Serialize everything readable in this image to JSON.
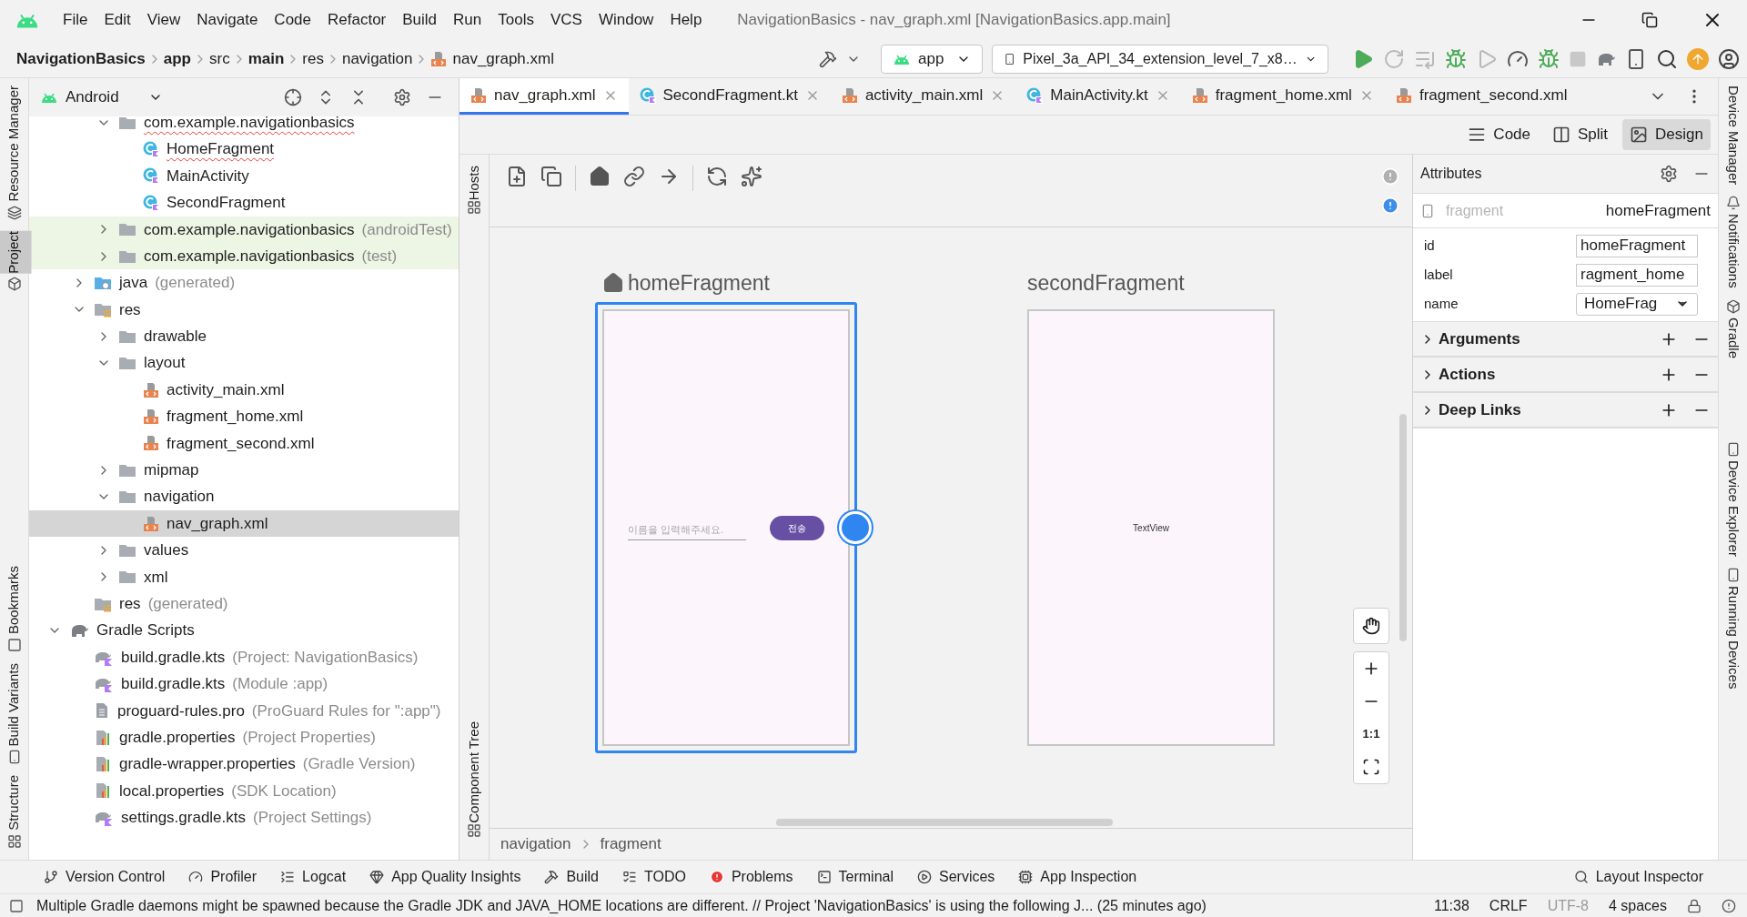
{
  "menu_bar": {
    "items": [
      "File",
      "Edit",
      "View",
      "Navigate",
      "Code",
      "Refactor",
      "Build",
      "Run",
      "Tools",
      "VCS",
      "Window",
      "Help"
    ],
    "title": "NavigationBasics - nav_graph.xml [NavigationBasics.app.main]"
  },
  "nav_bar": {
    "breadcrumbs": [
      {
        "label": "NavigationBasics",
        "bold": true,
        "kind": "plain"
      },
      {
        "label": "app",
        "bold": true,
        "kind": "plain"
      },
      {
        "label": "src",
        "bold": false,
        "kind": "plain"
      },
      {
        "label": "main",
        "bold": true,
        "kind": "plain"
      },
      {
        "label": "res",
        "bold": false,
        "kind": "plain"
      },
      {
        "label": "navigation",
        "bold": false,
        "kind": "plain"
      },
      {
        "label": "nav_graph.xml",
        "bold": false,
        "kind": "xml"
      }
    ],
    "run_config": "app",
    "device": "Pixel_3a_API_34_extension_level_7_x8…"
  },
  "left_stripe": [
    {
      "label": "Resource Manager",
      "selected": false
    },
    {
      "label": "Project",
      "selected": true
    },
    {
      "label": "Bookmarks",
      "selected": false
    },
    {
      "label": "Build Variants",
      "selected": false
    },
    {
      "label": "Structure",
      "selected": false
    }
  ],
  "project": {
    "view": "Android",
    "packages": [
      {
        "label": "com.example.navigationbasics",
        "kind": "folder",
        "expanded": true,
        "selected": false,
        "error": true,
        "children": [
          {
            "label": "HomeFragment",
            "kind": "class",
            "selected": false,
            "error": true
          },
          {
            "label": "MainActivity",
            "kind": "class",
            "selected": false
          },
          {
            "label": "SecondFragment",
            "kind": "class",
            "selected": false
          }
        ]
      },
      {
        "label": "com.example.navigationbasics",
        "note": "(androidTest)",
        "kind": "folder",
        "expanded": false,
        "selected": false,
        "test_source": true
      },
      {
        "label": "com.example.navigationbasics",
        "note": "(test)",
        "kind": "folder",
        "expanded": false,
        "selected": false,
        "test_source": true
      }
    ],
    "app_folders": [
      {
        "label": "java",
        "note": "(generated)",
        "kind": "gen",
        "expanded": false,
        "selected": false
      },
      {
        "label": "res",
        "kind": "res",
        "expanded": true,
        "selected": false,
        "children": [
          {
            "label": "drawable",
            "kind": "folder",
            "expanded": false,
            "selected": false
          },
          {
            "label": "layout",
            "kind": "folder",
            "expanded": true,
            "selected": false,
            "children": [
              {
                "label": "activity_main.xml",
                "kind": "xml",
                "selected": false
              },
              {
                "label": "fragment_home.xml",
                "kind": "xml",
                "selected": false
              },
              {
                "label": "fragment_second.xml",
                "kind": "xml",
                "selected": false
              }
            ]
          },
          {
            "label": "mipmap",
            "kind": "folder",
            "expanded": false,
            "selected": false
          },
          {
            "label": "navigation",
            "kind": "folder",
            "expanded": true,
            "selected": false,
            "children": [
              {
                "label": "nav_graph.xml",
                "kind": "xml",
                "selected": true
              }
            ]
          },
          {
            "label": "values",
            "kind": "folder",
            "expanded": false,
            "selected": false
          },
          {
            "label": "xml",
            "kind": "folder",
            "expanded": false,
            "selected": false
          }
        ]
      },
      {
        "label": "res",
        "note": "(generated)",
        "kind": "res",
        "selected": false
      }
    ],
    "gradle": [
      {
        "label": "Gradle Scripts",
        "kind": "gradle",
        "expanded": true,
        "selected": false,
        "children": [
          {
            "label": "build.gradle.kts",
            "note": "(Project: NavigationBasics)",
            "kind": "kts",
            "selected": false
          },
          {
            "label": "build.gradle.kts",
            "note": "(Module :app)",
            "kind": "kts",
            "selected": false
          },
          {
            "label": "proguard-rules.pro",
            "note": "(ProGuard Rules for \":app\")",
            "kind": "file",
            "selected": false
          },
          {
            "label": "gradle.properties",
            "note": "(Project Properties)",
            "kind": "props",
            "selected": false
          },
          {
            "label": "gradle-wrapper.properties",
            "note": "(Gradle Version)",
            "kind": "props",
            "selected": false
          },
          {
            "label": "local.properties",
            "note": "(SDK Location)",
            "kind": "props",
            "selected": false
          },
          {
            "label": "settings.gradle.kts",
            "note": "(Project Settings)",
            "kind": "kts",
            "selected": false
          }
        ]
      }
    ]
  },
  "editor_tabs": [
    {
      "label": "nav_graph.xml",
      "kind": "xml",
      "selected": true,
      "closable": true
    },
    {
      "label": "SecondFragment.kt",
      "kind": "class",
      "selected": false,
      "closable": true
    },
    {
      "label": "activity_main.xml",
      "kind": "xml",
      "selected": false,
      "closable": true
    },
    {
      "label": "MainActivity.kt",
      "kind": "class",
      "selected": false,
      "closable": true
    },
    {
      "label": "fragment_home.xml",
      "kind": "xml",
      "selected": false,
      "closable": true
    },
    {
      "label": "fragment_second.xml",
      "kind": "xml",
      "selected": false,
      "closable": false
    }
  ],
  "view_modes": [
    {
      "label": "Code",
      "selected": false
    },
    {
      "label": "Split",
      "selected": false
    },
    {
      "label": "Design",
      "selected": true
    }
  ],
  "design_side_tabs": [
    "Hosts",
    "Component Tree"
  ],
  "canvas": {
    "destinations": [
      {
        "title": "homeFragment",
        "start": true,
        "selected": true,
        "kind": "form",
        "placeholder": "이름을 입력해주세요.",
        "button": "전송"
      },
      {
        "title": "secondFragment",
        "start": false,
        "selected": false,
        "kind": "text",
        "text": "TextView"
      }
    ],
    "zoom_reset": "1:1"
  },
  "attributes": {
    "title": "Attributes",
    "component_type": "fragment",
    "component_id": "homeFragment",
    "fields": [
      {
        "label": "id",
        "value": "homeFragment",
        "kind": "text"
      },
      {
        "label": "label",
        "value": "ragment_home",
        "kind": "text"
      },
      {
        "label": "name",
        "value": "HomeFrag",
        "kind": "dropdown"
      }
    ],
    "sections": [
      {
        "label": "Arguments",
        "expanded": false
      },
      {
        "label": "Actions",
        "expanded": false
      },
      {
        "label": "Deep Links",
        "expanded": false
      }
    ]
  },
  "design_breadcrumb": [
    "navigation",
    "fragment"
  ],
  "right_stripe": [
    "Device Manager",
    "Notifications",
    "Gradle",
    "Device Explorer",
    "Running Devices"
  ],
  "tool_windows": [
    "Version Control",
    "Profiler",
    "Logcat",
    "App Quality Insights",
    "Build",
    "TODO",
    "Problems",
    "Terminal",
    "Services",
    "App Inspection"
  ],
  "layout_inspector": "Layout Inspector",
  "status": {
    "message": "Multiple Gradle daemons might be spawned because the Gradle JDK and JAVA_HOME locations are different. // Project 'NavigationBasics' is using the following J... (25 minutes ago)",
    "time": "11:38",
    "line_sep": "CRLF",
    "encoding": "UTF-8",
    "indent": "4 spaces"
  }
}
